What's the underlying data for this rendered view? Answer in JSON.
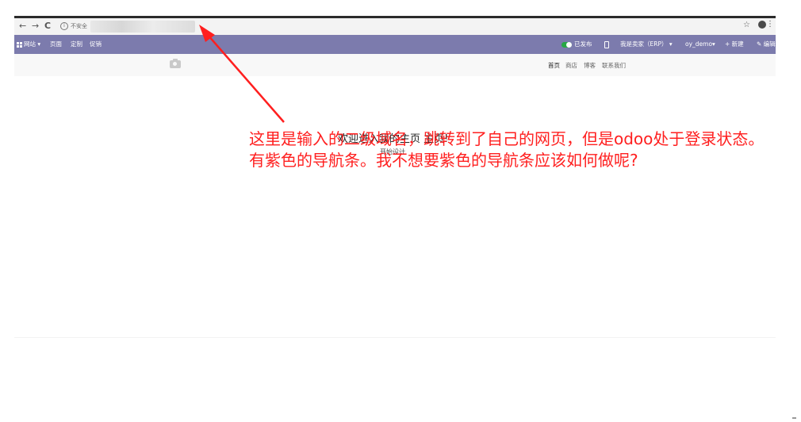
{
  "browser": {
    "back": "←",
    "forward": "→",
    "reload": "C",
    "security_label": "不安全",
    "star": "☆",
    "menu": "⋮"
  },
  "odoo_bar": {
    "apps_label": "网站",
    "apps_caret": "▾",
    "pages": "页面",
    "customize": "定制",
    "promote": "促销",
    "published_label": "已发布",
    "company": "我是卖家（ERP）",
    "company_caret": "▾",
    "user": "oy_demo",
    "user_caret": "▾",
    "new_label": "+ 新建",
    "edit_label": "✎ 编辑"
  },
  "site_header": {
    "menu": [
      "首页",
      "商店",
      "博客",
      "联系我们"
    ]
  },
  "content": {
    "welcome": "欢迎进入我的主页 主页!",
    "start_design": "开始设计"
  },
  "annotation": {
    "line1": "这里是输入的二级域名，跳转到了自己的网页，但是odoo处于登录状态。",
    "line2": "有紫色的导航条。我不想要紫色的导航条应该如何做呢?",
    "color": "#ff1f1f"
  },
  "colors": {
    "odoo_purple": "#7c7bad",
    "toggle_green": "#28a745"
  }
}
